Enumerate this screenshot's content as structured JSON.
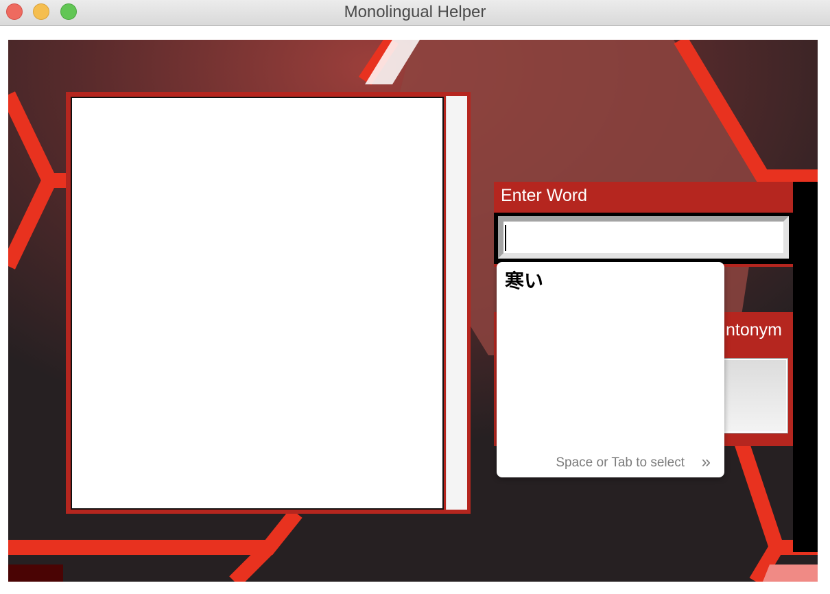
{
  "window": {
    "title": "Monolingual Helper"
  },
  "word_panel": {
    "label": "Enter Word",
    "input_value": ""
  },
  "antonym_panel": {
    "label_visible_fragment": "ntonym"
  },
  "ime_popup": {
    "candidate": "寒い",
    "hint": "Space or Tab to select",
    "more_glyph": "»"
  },
  "colors": {
    "panel_red": "#b5261f",
    "background_dark": "#2b2425",
    "accent_red": "#e8321f"
  }
}
